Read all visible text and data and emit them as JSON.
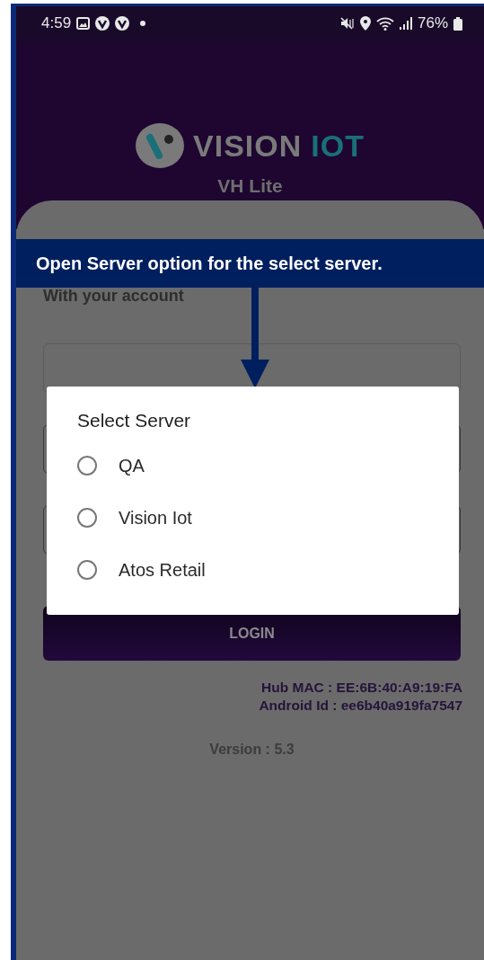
{
  "status_bar": {
    "time": "4:59",
    "battery": "76%"
  },
  "header": {
    "logo": {
      "word_1": "VISION",
      "word_2": "IOT"
    },
    "app_name": "VH Lite"
  },
  "login": {
    "subtitle": "With your account",
    "button": "LOGIN",
    "hub_mac": "Hub MAC : EE:6B:40:A9:19:FA",
    "android_id": "Android Id : ee6b40a919fa7547",
    "version": "Version : 5.3"
  },
  "dialog": {
    "title": "Select Server",
    "options": [
      {
        "label": "QA",
        "selected": false
      },
      {
        "label": "Vision Iot",
        "selected": false
      },
      {
        "label": "Atos Retail",
        "selected": false
      }
    ]
  },
  "callout": {
    "text": "Open Server option for the select server."
  }
}
